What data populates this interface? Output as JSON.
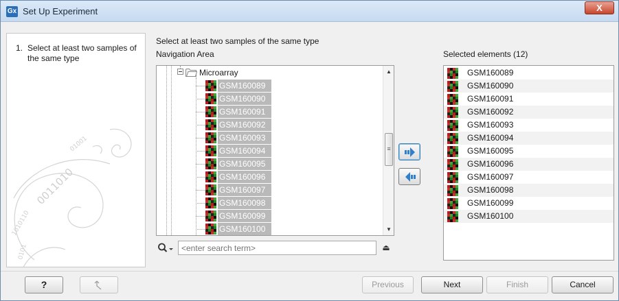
{
  "window": {
    "title": "Set Up Experiment",
    "app_icon_text": "Gx",
    "close_symbol": "X"
  },
  "steps": [
    {
      "number": "1.",
      "label": "Select at least two samples of the same type"
    }
  ],
  "main": {
    "header": "Select at least two samples of the same type",
    "navigation_label": "Navigation Area",
    "selected_label": "Selected elements (12)"
  },
  "tree": {
    "folder_label": "Microarray",
    "items": [
      "GSM160089",
      "GSM160090",
      "GSM160091",
      "GSM160092",
      "GSM160093",
      "GSM160094",
      "GSM160095",
      "GSM160096",
      "GSM160097",
      "GSM160098",
      "GSM160099",
      "GSM160100"
    ]
  },
  "search": {
    "placeholder": "<enter search term>"
  },
  "selected": {
    "items": [
      "GSM160089",
      "GSM160090",
      "GSM160091",
      "GSM160092",
      "GSM160093",
      "GSM160094",
      "GSM160095",
      "GSM160096",
      "GSM160097",
      "GSM160098",
      "GSM160099",
      "GSM160100"
    ]
  },
  "buttons": {
    "help": "?",
    "previous": "Previous",
    "next": "Next",
    "finish": "Finish",
    "cancel": "Cancel"
  },
  "colors": {
    "selection_gray": "#b9b9b9",
    "title_bar": "#c6daf0",
    "close_red": "#c7452c",
    "arrow_blue": "#2f7fd0"
  }
}
